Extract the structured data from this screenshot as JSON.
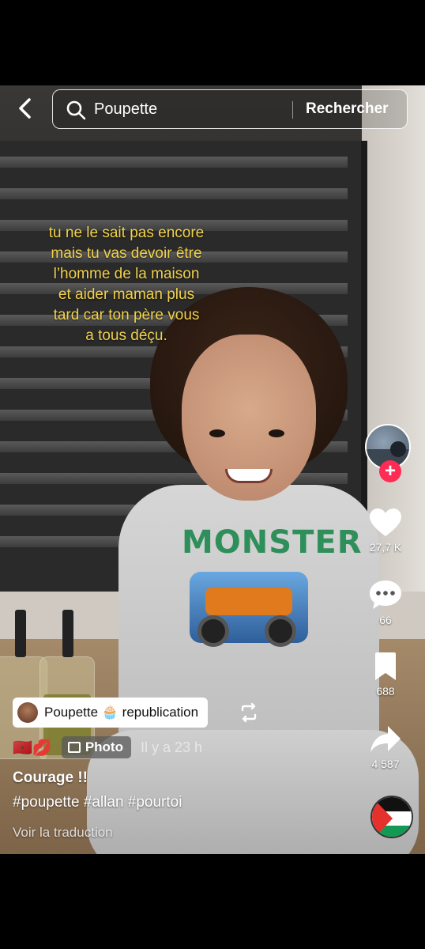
{
  "search": {
    "query": "Poupette",
    "submit_label": "Rechercher"
  },
  "overlay_text": "tu ne le sait pas encore\nmais tu vas devoir être\nl’homme de la maison\net aider maman plus\ntard car ton père vous\na tous déçu.",
  "shirt_print": "MONSTER",
  "rail": {
    "likes": "27,7 K",
    "comments": "66",
    "saves": "688",
    "shares": "4 587"
  },
  "repost": {
    "label": "Poupette 🧁 republication"
  },
  "meta": {
    "emojis": "🇲🇦💋",
    "badge_label": "Photo",
    "time": "Il y a 23 h"
  },
  "post": {
    "title": "Courage !!",
    "hashtags": "#poupette #allan #pourtoi",
    "translate_label": "Voir la traduction"
  },
  "colors": {
    "accent_pink": "#fe2c55",
    "overlay_yellow": "#f2d24b"
  },
  "icons": [
    "back-arrow-icon",
    "search-icon",
    "heart-icon",
    "comment-icon",
    "bookmark-icon",
    "share-icon",
    "repost-icon",
    "photo-icon",
    "palestine-flag-icon"
  ]
}
